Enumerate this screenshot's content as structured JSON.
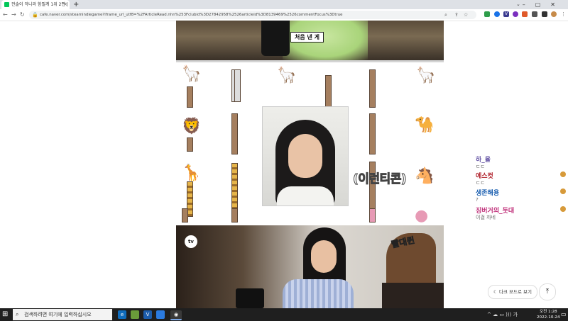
{
  "browser": {
    "tab_title": "전술이 악니라 함필계 1위 2편 |",
    "tab_close": "×",
    "new_tab": "+",
    "tab_dropdown": "⌄",
    "window_controls": "–▢✕",
    "url": "cafe.naver.com/steamindiegame?iframe_url_utf8=%2FArticleRead.nhn%253Fclubid%3D27842958%2526articleid%3D8139469%2526commentFocus%3Dtrue",
    "back": "←",
    "forward": "→",
    "reload": "↻",
    "lock": "🔒",
    "menu": "⋮"
  },
  "article": {
    "top_caption": "처음 낸 게",
    "mid_label": "(이런티콘)",
    "tv_logo": "tv",
    "bottom_brand": "빨대퀸"
  },
  "chat": [
    {
      "name": "하_율",
      "msg": "ㄷㄷ",
      "color": "#6a5aa8"
    },
    {
      "name": "에스컷",
      "msg": "ㄷㄷ",
      "color": "#b0202a"
    },
    {
      "name": "생존해용",
      "msg": "?",
      "color": "#1b5fb0"
    },
    {
      "name": "징버거의_둣대",
      "msg": "이걸 까네",
      "color": "#c0307a"
    }
  ],
  "buttons": {
    "dark_mode": "다크 모드로 보기",
    "scroll_top": "⤒"
  },
  "taskbar": {
    "start": "⊞",
    "search_placeholder": "검색하려면 여기에 입력하십시오",
    "search_icon": "⌕",
    "tray_icons": "^ ☁ ▭ ))) 가",
    "time": "오전 1:28",
    "date": "2022-10-24",
    "notification": "▭"
  }
}
